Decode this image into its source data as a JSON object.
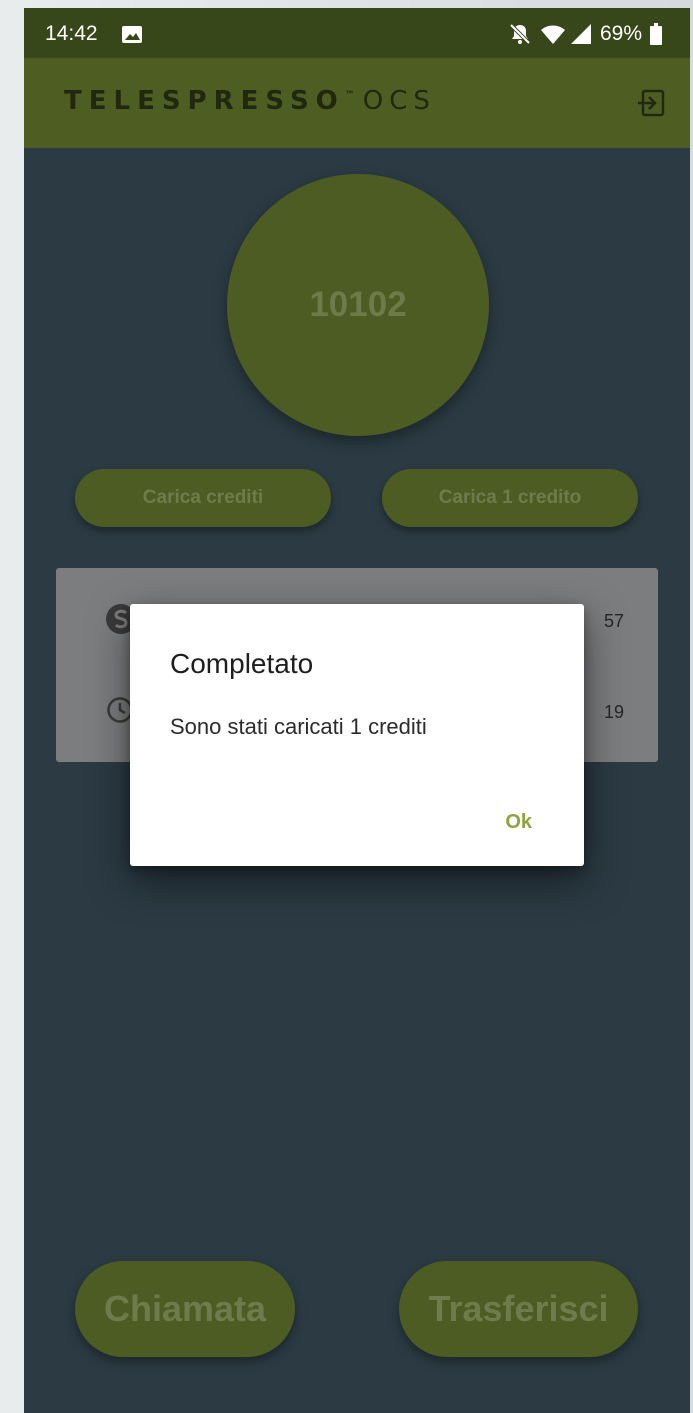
{
  "status_bar": {
    "time": "14:42",
    "battery": "69%",
    "icons": [
      "image-icon",
      "bell-off-icon",
      "wifi-icon",
      "signal-icon",
      "battery-icon"
    ]
  },
  "app_bar": {
    "logo_main": "TELESPRESSO",
    "logo_tm": "™",
    "logo_suffix": "OCS",
    "logout_icon": "logout-icon"
  },
  "counter": {
    "value": "10102"
  },
  "buttons": {
    "load_credits": "Carica crediti",
    "load_one_credit": "Carica 1 credito",
    "call": "Chiamata",
    "transfer": "Trasferisci"
  },
  "info_card": {
    "rows": [
      {
        "icon": "credit-icon",
        "value": "57"
      },
      {
        "icon": "clock-icon",
        "value": "19"
      }
    ]
  },
  "dialog": {
    "title": "Completato",
    "message": "Sono stati caricati 1 crediti",
    "ok_label": "Ok"
  },
  "colors": {
    "accent": "#4d5c22",
    "status_bar": "#374719",
    "background": "#2b3a43",
    "ok_text": "#8ea43f"
  }
}
